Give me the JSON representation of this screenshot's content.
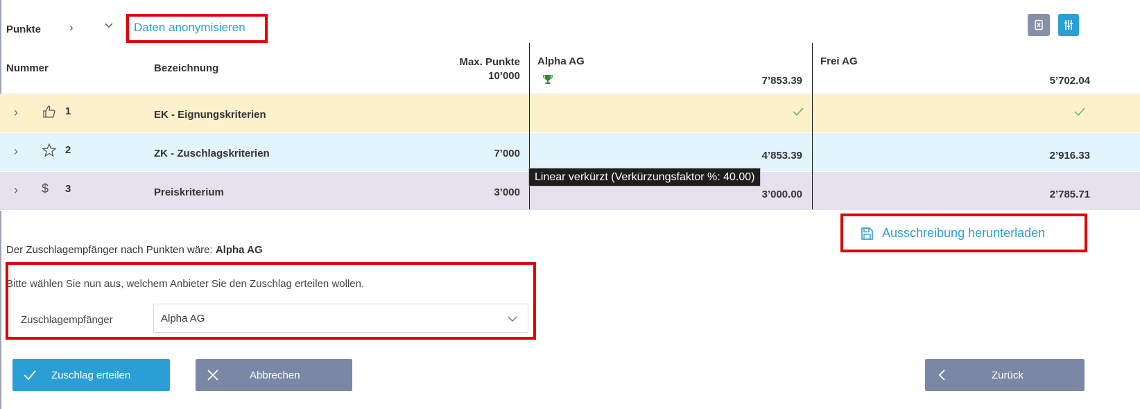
{
  "toolbar": {
    "breadcrumb_root": "Punkte",
    "anonymize_link": "Daten anonymisieren"
  },
  "table": {
    "headers": {
      "number": "Nummer",
      "designation": "Bezeichnung",
      "max_points_label": "Max. Punkte",
      "max_points_total": "10’000"
    },
    "bidders": [
      {
        "name": "Alpha AG",
        "total": "7’853.39",
        "winner": true
      },
      {
        "name": "Frei AG",
        "total": "5’702.04",
        "winner": false
      }
    ],
    "rows": [
      {
        "number": "1",
        "icon": "thumbs-up-icon",
        "designation": "EK - Eignungskriterien",
        "max_points": "",
        "values": [
          "",
          ""
        ],
        "checks": [
          true,
          true
        ]
      },
      {
        "number": "2",
        "icon": "star-icon",
        "designation": "ZK - Zuschlagskriterien",
        "max_points": "7’000",
        "values": [
          "4’853.39",
          "2’916.33"
        ],
        "checks": [
          false,
          false
        ]
      },
      {
        "number": "3",
        "icon": "dollar-icon",
        "designation": "Preiskriterium",
        "max_points": "3’000",
        "values": [
          "3’000.00",
          "2’785.71"
        ],
        "checks": [
          false,
          false
        ]
      }
    ]
  },
  "tooltip": "Linear verkürzt (Verkürzungsfaktor %: 40.00)",
  "download_label": "Ausschreibung herunterladen",
  "award": {
    "info_prefix": "Der Zuschlagempfänger nach Punkten wäre: ",
    "info_winner": "Alpha AG",
    "instruction": "Bitte wählen Sie nun aus, welchem Anbieter Sie den Zuschlag erteilen wollen.",
    "select_label": "Zuschlagempfänger",
    "select_value": "Alpha AG"
  },
  "buttons": {
    "award": "Zuschlag erteilen",
    "cancel": "Abbrechen",
    "back": "Zurück"
  },
  "colors": {
    "accent": "#2a9fd6",
    "secondary": "#7a88a6",
    "highlight_box": "#e30000",
    "row_ek": "#fdf1cc",
    "row_zk": "#e3f5fc",
    "row_pk": "#e6e0ef",
    "check": "#5cb85c",
    "trophy": "#2e8b2e"
  }
}
